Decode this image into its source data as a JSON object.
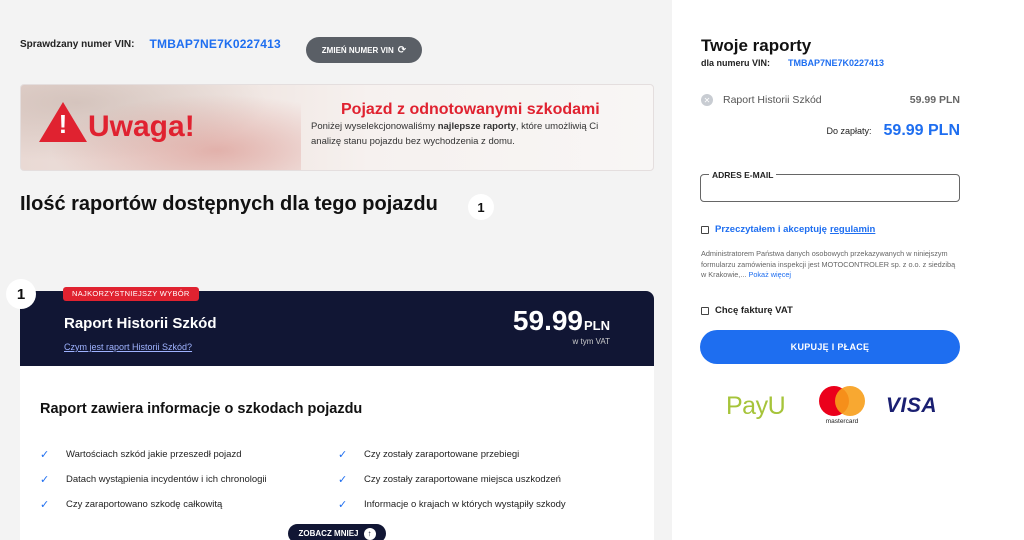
{
  "vin_bar": {
    "label": "Sprawdzany numer VIN:",
    "vin": "TMBAP7NE7K0227413",
    "change_button": "ZMIEŃ NUMER VIN"
  },
  "warning": {
    "title": "Uwaga!",
    "headline": "Pojazd z odnotowanymi szkodami",
    "desc_before": "Poniżej wyselekcjonowaliśmy ",
    "desc_bold": "najlepsze raporty",
    "desc_after": ", które umożliwią Ci analizę stanu pojazdu bez wychodzenia z domu."
  },
  "reports": {
    "heading": "Ilość raportów dostępnych dla tego pojazdu",
    "count": "1"
  },
  "card": {
    "number": "1",
    "badge": "NAJKORZYSTNIEJSZY WYBÓR",
    "title": "Raport Historii Szkód",
    "link": "Czym jest raport Historii Szkód?",
    "price": "59.99",
    "currency": "PLN",
    "vat_note": "w tym VAT",
    "body_title": "Raport zawiera informacje o szkodach pojazdu",
    "features_left": [
      "Wartościach szkód jakie przeszedł pojazd",
      "Datach wystąpienia incydentów i ich chronologii",
      "Czy zaraportowano szkodę całkowitą"
    ],
    "features_right": [
      "Czy zostały zaraportowane przebiegi",
      "Czy zostały zaraportowane miejsca uszkodzeń",
      "Informacje o krajach w których wystąpiły szkody"
    ],
    "more_button": "ZOBACZ MNIEJ"
  },
  "sidebar": {
    "title": "Twoje raporty",
    "vin_label": "dla numeru VIN:",
    "vin": "TMBAP7NE7K0227413",
    "item_name": "Raport Historii Szkód",
    "item_price": "59.99 PLN",
    "total_label": "Do zapłaty:",
    "total_amount": "59.99 PLN",
    "email_label": "ADRES E-MAIL",
    "email_value": "",
    "terms_text": "Przeczytałem i akceptuję",
    "terms_link": "regulamin",
    "rodo_text": "Administratorem Państwa danych osobowych przekazywanych w niniejszym formularzu zamówienia inspekcji jest MOTOCONTROLER sp. z o.o. z siedzibą w Krakowie,...",
    "rodo_more": "Pokaż więcej",
    "vat_text": "Chcę fakturę VAT",
    "buy_button": "KUPUJĘ I PŁACĘ",
    "payu": "PayU",
    "mastercard": "mastercard",
    "visa": "VISA"
  },
  "colors": {
    "accent": "#1e6ef0",
    "danger": "#e02230",
    "navy": "#111634",
    "payu_green": "#a6c43a"
  }
}
